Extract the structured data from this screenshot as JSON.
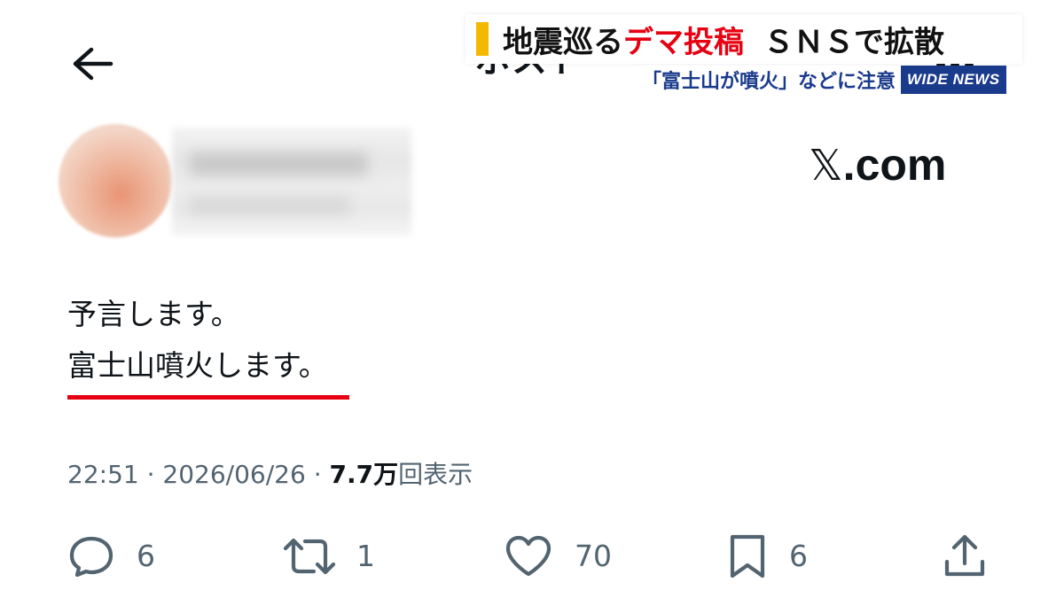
{
  "topbar": {
    "title": "ポスト"
  },
  "caption": {
    "headline_black_1": "地震巡る",
    "headline_red": "デマ投稿",
    "headline_black_2": "ＳＮＳで拡散",
    "subline": "「富士山が噴火」などに注意",
    "logo": "WIDE NEWS"
  },
  "profile": {
    "site_label": ".com"
  },
  "post": {
    "line1": "予言します。",
    "line2": "富士山噴火します。"
  },
  "meta": {
    "time": "22:51",
    "date": "2026/06/26",
    "views_number": "7.7万",
    "views_label": "回表示",
    "separator": " · "
  },
  "actions": {
    "reply_count": "6",
    "repost_count": "1",
    "like_count": "70",
    "bookmark_count": "6"
  },
  "colors": {
    "accent_red": "#e60012",
    "caption_yellow": "#f5b800",
    "caption_blue": "#1a3a8c",
    "muted_gray": "#536471",
    "text_black": "#0f1419"
  },
  "icons": {
    "back": "back-arrow-icon",
    "more": "more-icon",
    "reply": "reply-icon",
    "repost": "repost-icon",
    "like": "heart-icon",
    "bookmark": "bookmark-icon",
    "share": "share-icon",
    "logo_x": "x-logo-icon"
  }
}
